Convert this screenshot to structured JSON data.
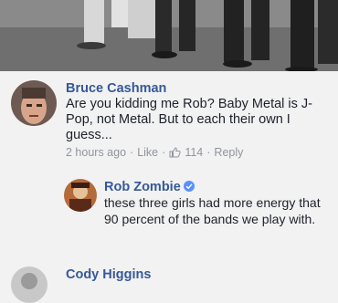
{
  "post_image": {
    "alt_icon": "photo-icon"
  },
  "comments": [
    {
      "author": "Bruce Cashman",
      "text": "Are you kidding me Rob? Baby Metal is J-Pop, not Metal. But to each their own I guess...",
      "time": "2 hours ago",
      "like_label": "Like",
      "like_count": "114",
      "reply_label": "Reply"
    }
  ],
  "reply": {
    "author": "Rob Zombie",
    "verified_icon": "verified-badge-icon",
    "text": "these three girls had more energy that 90 percent of the bands we play with."
  },
  "next_comment": {
    "author": "Cody Higgins"
  },
  "colors": {
    "name": "#365899",
    "text": "#1d2129",
    "meta": "#90949c",
    "verified": "#5890ff"
  }
}
